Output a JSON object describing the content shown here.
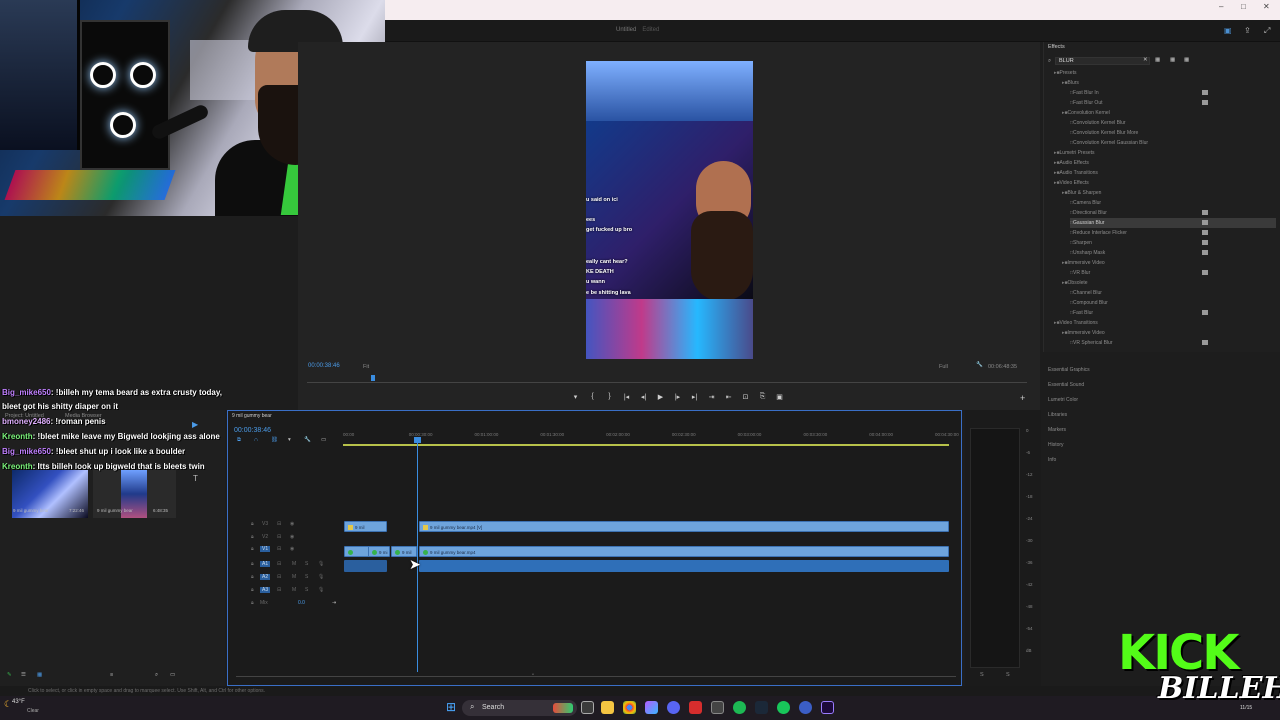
{
  "window": {
    "controls": [
      "–",
      "□",
      "✕"
    ]
  },
  "document": {
    "title": "Untitled",
    "state": "Edited"
  },
  "program_monitor": {
    "timecode_current": "00:00:38:46",
    "fit_label": "Fit",
    "full_label": "Full",
    "timecode_duration": "00:06:48:35",
    "captions": [
      "u said on ici",
      "ees",
      "get fucked up bro",
      "eally cant hear?",
      "KE DEATH",
      "u wann",
      "e be shitting lava"
    ],
    "transport": [
      "▾",
      "{",
      "}",
      "|◂",
      "◂|",
      "▶",
      "|▸",
      "▸|",
      "⇥",
      "⇤",
      "⊡",
      "⎘",
      "▣"
    ]
  },
  "effects_panel": {
    "title": "Effects",
    "search_value": "BLUR",
    "tree": [
      {
        "label": "Presets",
        "kind": "folder",
        "indent": 0
      },
      {
        "label": "Blurs",
        "kind": "folder",
        "indent": 1
      },
      {
        "label": "Fast Blur In",
        "kind": "item",
        "indent": 2,
        "badge": true
      },
      {
        "label": "Fast Blur Out",
        "kind": "item",
        "indent": 2,
        "badge": true
      },
      {
        "label": "Convolution Kernel",
        "kind": "folder",
        "indent": 1
      },
      {
        "label": "Convolution Kernel Blur",
        "kind": "item",
        "indent": 2
      },
      {
        "label": "Convolution Kernel Blur More",
        "kind": "item",
        "indent": 2
      },
      {
        "label": "Convolution Kernel Gaussian Blur",
        "kind": "item",
        "indent": 2
      },
      {
        "label": "Lumetri Presets",
        "kind": "folder",
        "indent": 0
      },
      {
        "label": "Audio Effects",
        "kind": "folder",
        "indent": 0
      },
      {
        "label": "Audio Transitions",
        "kind": "folder",
        "indent": 0
      },
      {
        "label": "Video Effects",
        "kind": "folder",
        "indent": 0
      },
      {
        "label": "Blur & Sharpen",
        "kind": "folder",
        "indent": 1
      },
      {
        "label": "Camera Blur",
        "kind": "item",
        "indent": 2
      },
      {
        "label": "Directional Blur",
        "kind": "item",
        "indent": 2,
        "badge": true
      },
      {
        "label": "Gaussian Blur",
        "kind": "item",
        "indent": 2,
        "badge": true,
        "selected": true
      },
      {
        "label": "Reduce Interlace Flicker",
        "kind": "item",
        "indent": 2,
        "badge": true
      },
      {
        "label": "Sharpen",
        "kind": "item",
        "indent": 2,
        "badge": true
      },
      {
        "label": "Unsharp Mask",
        "kind": "item",
        "indent": 2,
        "badge": true
      },
      {
        "label": "Immersive Video",
        "kind": "folder",
        "indent": 1
      },
      {
        "label": "VR Blur",
        "kind": "item",
        "indent": 2,
        "badge": true
      },
      {
        "label": "Obsolete",
        "kind": "folder",
        "indent": 1
      },
      {
        "label": "Channel Blur",
        "kind": "item",
        "indent": 2
      },
      {
        "label": "Compound Blur",
        "kind": "item",
        "indent": 2
      },
      {
        "label": "Fast Blur",
        "kind": "item",
        "indent": 2,
        "badge": true
      },
      {
        "label": "Video Transitions",
        "kind": "folder",
        "indent": 0
      },
      {
        "label": "Immersive Video",
        "kind": "folder",
        "indent": 1
      },
      {
        "label": "VR Spherical Blur",
        "kind": "item",
        "indent": 2,
        "badge": true
      }
    ]
  },
  "side_panels": [
    "Essential Graphics",
    "Essential Sound",
    "Lumetri Color",
    "Libraries",
    "Markers",
    "History",
    "Info"
  ],
  "chat": [
    {
      "user": "Big_mike650",
      "message": ": !billeh my tema beard as extra crusty today,",
      "color": "purple"
    },
    {
      "user": "",
      "message": "bleet got his shitty diaper on it",
      "color": ""
    },
    {
      "user": "bmoney2486",
      "message": ": !roman penis",
      "color": "purple"
    },
    {
      "user": "Kreonth",
      "message": ": !bleet mike leave my Bigweld lookjing ass alone",
      "color": "green"
    },
    {
      "user": "Big_mike650",
      "message": ": !bleet shut up i look like a boulder",
      "color": "purple"
    },
    {
      "user": "Kreonth",
      "message": ": Itts billeh look up bigweld that is bleets twin",
      "color": "green"
    }
  ],
  "project_panel": {
    "tabs": [
      "Project: Untitled",
      "Media Browser"
    ],
    "items": [
      {
        "name": "9 mil gummy bear",
        "duration": "7:22:46"
      },
      {
        "name": "9 mil gummy bear",
        "duration": "6:48:35"
      }
    ]
  },
  "timeline": {
    "sequence_tab": "9 mil gummy bear",
    "timecode": "00:00:38:46",
    "ruler": [
      "00:00",
      "00:00:30:00",
      "00:01:00:00",
      "00:01:30:00",
      "00:02:00:00",
      "00:02:30:00",
      "00:03:00:00",
      "00:03:30:00",
      "00:04:00:00",
      "00:04:30:00"
    ],
    "tracks": [
      "V3",
      "V2",
      "V1",
      "A1",
      "A2",
      "A3",
      "Mix"
    ],
    "mix_value": "0.0",
    "clips": {
      "v3_a": "9 mil",
      "v3_b": "9 mil gummy bear.mp4 [V]",
      "v1_a": "9 mi",
      "v1_b": "9 mil",
      "v1_c": "9 mil gummy bear.mp4"
    }
  },
  "meters": {
    "labels": [
      "0",
      "-6",
      "-12",
      "-18",
      "-24",
      "-30",
      "-36",
      "-42",
      "-48",
      "-54",
      "dB"
    ],
    "bottom": [
      "S",
      "S"
    ]
  },
  "status_text": "Click to select, or click in empty space and drag to marquee select. Use Shift, Alt, and Ctrl for other options.",
  "taskbar": {
    "temperature": "43°F",
    "condition": "Clear",
    "search_placeholder": "Search",
    "clock": "11/15"
  },
  "branding": {
    "line1": "KICK",
    "line2": "BILLEH"
  }
}
